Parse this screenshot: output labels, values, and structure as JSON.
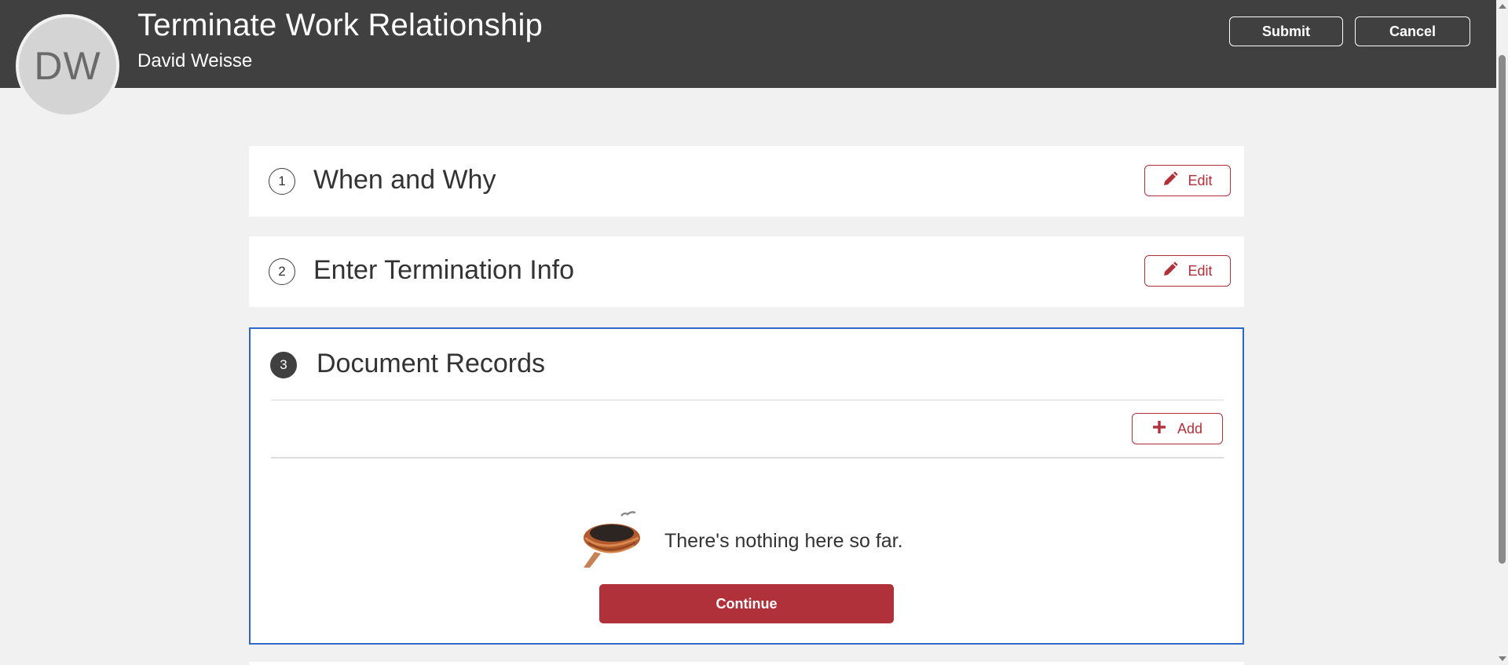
{
  "header": {
    "avatar_initials": "DW",
    "title": "Terminate Work Relationship",
    "subtitle": "David Weisse",
    "submit_label": "Submit",
    "cancel_label": "Cancel"
  },
  "steps": [
    {
      "number": "1",
      "title": "When and Why",
      "edit_label": "Edit"
    },
    {
      "number": "2",
      "title": "Enter Termination Info",
      "edit_label": "Edit"
    },
    {
      "number": "3",
      "title": "Document Records"
    }
  ],
  "document_records": {
    "add_label": "Add",
    "empty_message": "There's nothing here so far.",
    "continue_label": "Continue"
  },
  "colors": {
    "header_bg": "#404040",
    "accent": "#b0313a",
    "active_border": "#2f67c9",
    "page_bg": "#f1f1f1"
  },
  "icons": [
    "pencil-icon",
    "plus-icon",
    "empty-nest-icon"
  ]
}
